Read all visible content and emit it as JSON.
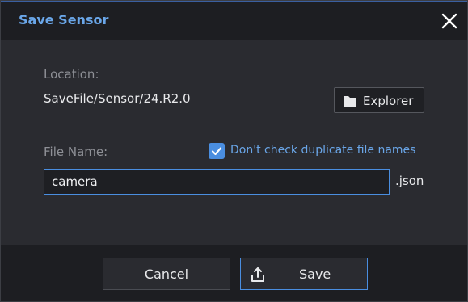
{
  "dialog": {
    "title": "Save Sensor",
    "close_icon": "close-icon"
  },
  "location": {
    "label": "Location:",
    "path": "SaveFile/Sensor/24.R2.0",
    "explorer_label": "Explorer",
    "explorer_icon": "folder-icon"
  },
  "file": {
    "label": "File Name:",
    "value": "camera",
    "extension": ".json",
    "duplicate_check_label": "Don't check duplicate file names",
    "duplicate_check_checked": true
  },
  "footer": {
    "cancel_label": "Cancel",
    "save_label": "Save",
    "save_icon": "upload-icon"
  },
  "colors": {
    "accent": "#4a8ee0",
    "title": "#6aa6e8",
    "background": "#2a2b30"
  }
}
